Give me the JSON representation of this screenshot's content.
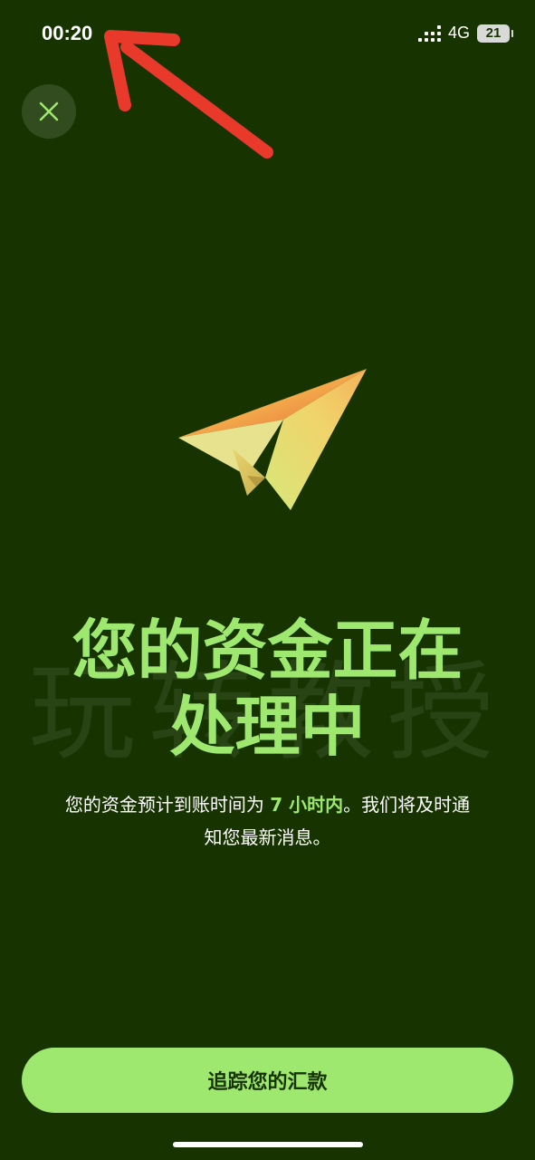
{
  "status_bar": {
    "time": "00:20",
    "network": "4G",
    "battery": "21"
  },
  "close_button": {
    "icon": "close-icon"
  },
  "illustration": {
    "icon": "paper-plane-icon"
  },
  "watermark": {
    "text": "玩转教授"
  },
  "headline": {
    "line1": "您的资金正在",
    "line2": "处理中"
  },
  "description": {
    "prefix": "您的资金预计到账时间为 ",
    "highlight": "7 小时内",
    "suffix_line1": "。我们将及时通",
    "suffix_line2": "知您最新消息。"
  },
  "primary_button": {
    "label": "追踪您的汇款"
  },
  "colors": {
    "background": "#163300",
    "accent": "#9fe870",
    "annotation": "#e8392b"
  }
}
